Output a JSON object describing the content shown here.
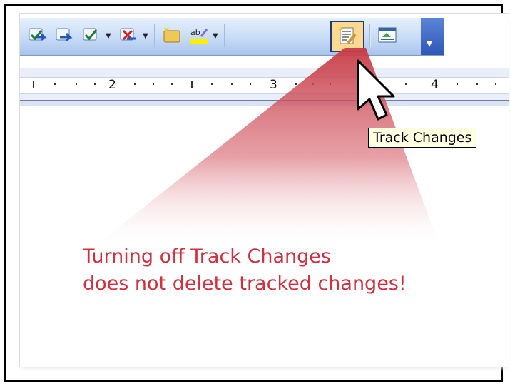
{
  "toolbar": {
    "buttons": [
      {
        "icon": "accept-change-icon"
      },
      {
        "icon": "next-change-icon"
      },
      {
        "icon": "accept-all-icon"
      },
      {
        "icon": "reject-change-icon"
      },
      {
        "icon": "new-comment-icon"
      },
      {
        "icon": "highlight-icon"
      },
      {
        "icon": "track-changes-icon",
        "state": "pressed"
      },
      {
        "icon": "reviewing-pane-icon"
      }
    ],
    "overflow_icon": "toolbar-options-icon"
  },
  "ruler": {
    "labels": [
      "2",
      "3",
      "4"
    ]
  },
  "tooltip": {
    "text": "Track Changes"
  },
  "callout": {
    "line1": "Turning off Track Changes",
    "line2": "does not delete tracked changes!"
  },
  "colors": {
    "callout_text": "#d3303f",
    "spotlight": "#c63a46",
    "toolbar_blue": "#c7dbf6",
    "tooltip_bg": "#ffffe1"
  }
}
